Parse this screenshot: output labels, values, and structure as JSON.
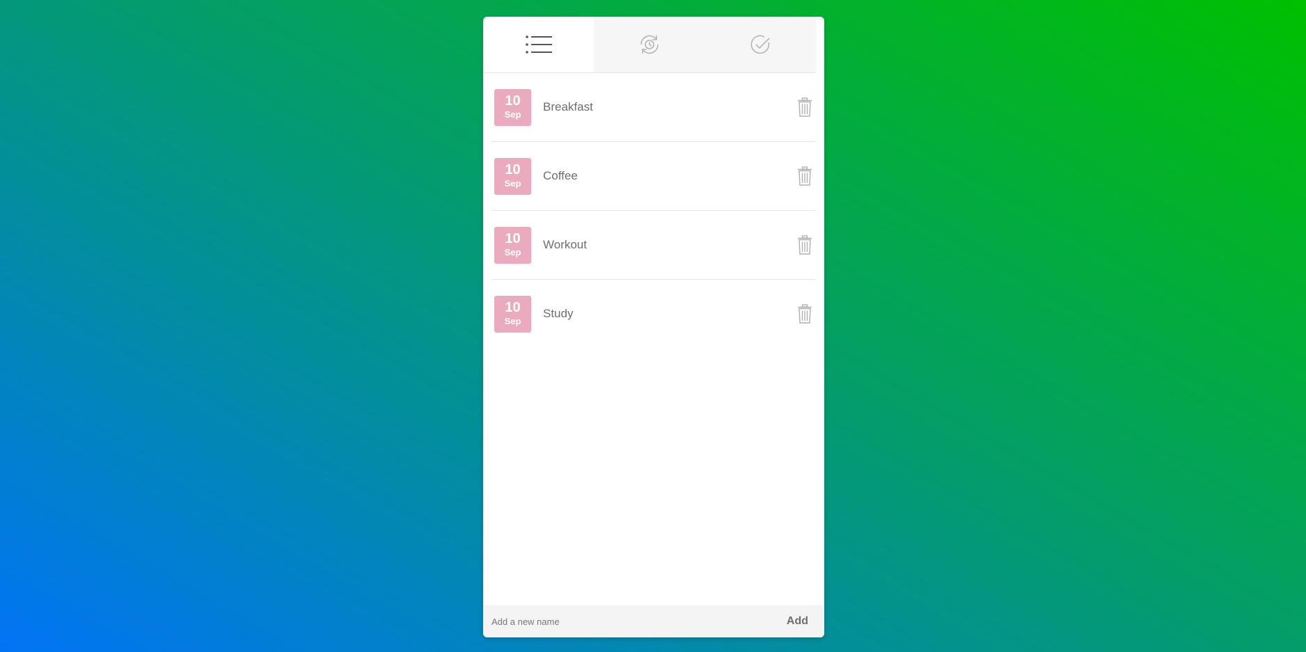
{
  "tabs": [
    {
      "id": "all",
      "icon": "list-icon",
      "active": true
    },
    {
      "id": "pending",
      "icon": "clock-refresh-icon",
      "active": false
    },
    {
      "id": "completed",
      "icon": "check-circle-icon",
      "active": false
    }
  ],
  "items": [
    {
      "day": "10",
      "month": "Sep",
      "name": "Breakfast"
    },
    {
      "day": "10",
      "month": "Sep",
      "name": "Coffee"
    },
    {
      "day": "10",
      "month": "Sep",
      "name": "Workout"
    },
    {
      "day": "10",
      "month": "Sep",
      "name": "Study"
    }
  ],
  "footer": {
    "placeholder": "Add a new name",
    "add_label": "Add"
  },
  "colors": {
    "date_badge": "#ebabbe",
    "gradient_start": "#0174f6",
    "gradient_end": "#00c000"
  }
}
